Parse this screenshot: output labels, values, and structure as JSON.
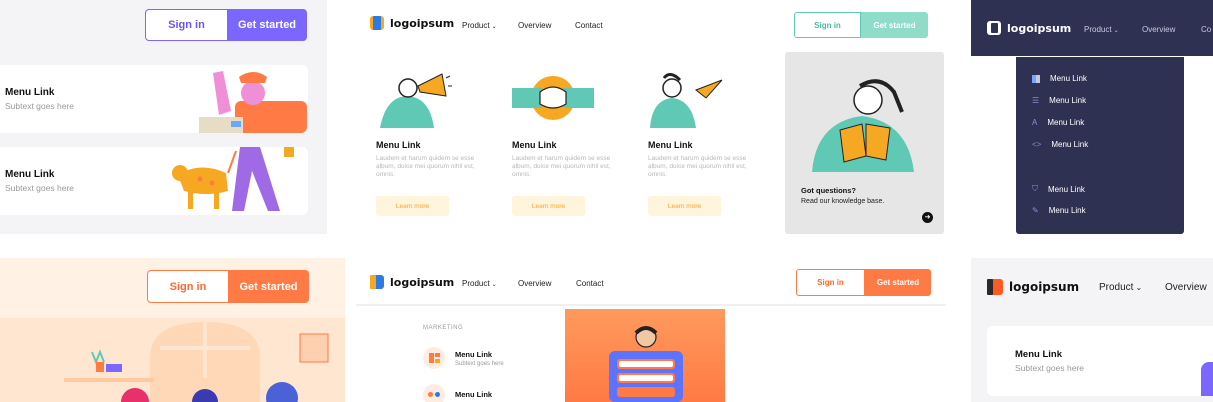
{
  "colors": {
    "purple": "#7b66ff",
    "teal": "#5fc9b6",
    "orange": "#ff7a45",
    "navy": "#2f3152",
    "peach": "#fff1e4",
    "gold": "#f7a823"
  },
  "panel_a": {
    "sign_in": "Sign in",
    "get_started": "Get started",
    "items": [
      {
        "title": "Menu Link",
        "sub": "Subtext goes here"
      },
      {
        "title": "Menu Link",
        "sub": "Subtext goes here"
      }
    ]
  },
  "panel_b": {
    "logo": "logoipsum",
    "nav": {
      "product": "Product",
      "overview": "Overview",
      "contact": "Contact"
    },
    "sign_in": "Sign in",
    "get_started": "Get started",
    "cards": [
      {
        "title": "Menu Link",
        "desc": "Laudem et harum quidem se esse album, dulce mei quorum nihil est, omnis.",
        "cta": "Learn more"
      },
      {
        "title": "Menu Link",
        "desc": "Laudem et harum quidem se esse album, dulce mei quorum nihil est, omnis.",
        "cta": "Learn more"
      },
      {
        "title": "Menu Link",
        "desc": "Laudem et harum quidem se esse album, dulce mei quorum nihil est, omnis.",
        "cta": "Learn more"
      }
    ],
    "questions_title": "Got questions?",
    "questions_sub": "Read our knowledge base."
  },
  "panel_c": {
    "logo": "logoipsum",
    "nav": {
      "product": "Product",
      "overview": "Overview",
      "contact": "Co"
    },
    "items": [
      "Menu Link",
      "Menu Link",
      "Menu Link",
      "Menu Link",
      "Menu Link",
      "Menu Link"
    ]
  },
  "panel_d": {
    "sign_in": "Sign in",
    "get_started": "Get started"
  },
  "panel_e": {
    "logo": "logoipsum",
    "nav": {
      "product": "Product",
      "overview": "Overview",
      "contact": "Contact"
    },
    "sign_in": "Sign in",
    "get_started": "Get started",
    "section_label": "MARKETING",
    "items": [
      {
        "title": "Menu Link",
        "sub": "Subtext goes here"
      },
      {
        "title": "Menu Link"
      }
    ]
  },
  "panel_f": {
    "logo": "logoipsum",
    "nav": {
      "product": "Product",
      "overview": "Overview"
    },
    "item": {
      "title": "Menu Link",
      "sub": "Subtext goes here"
    }
  }
}
